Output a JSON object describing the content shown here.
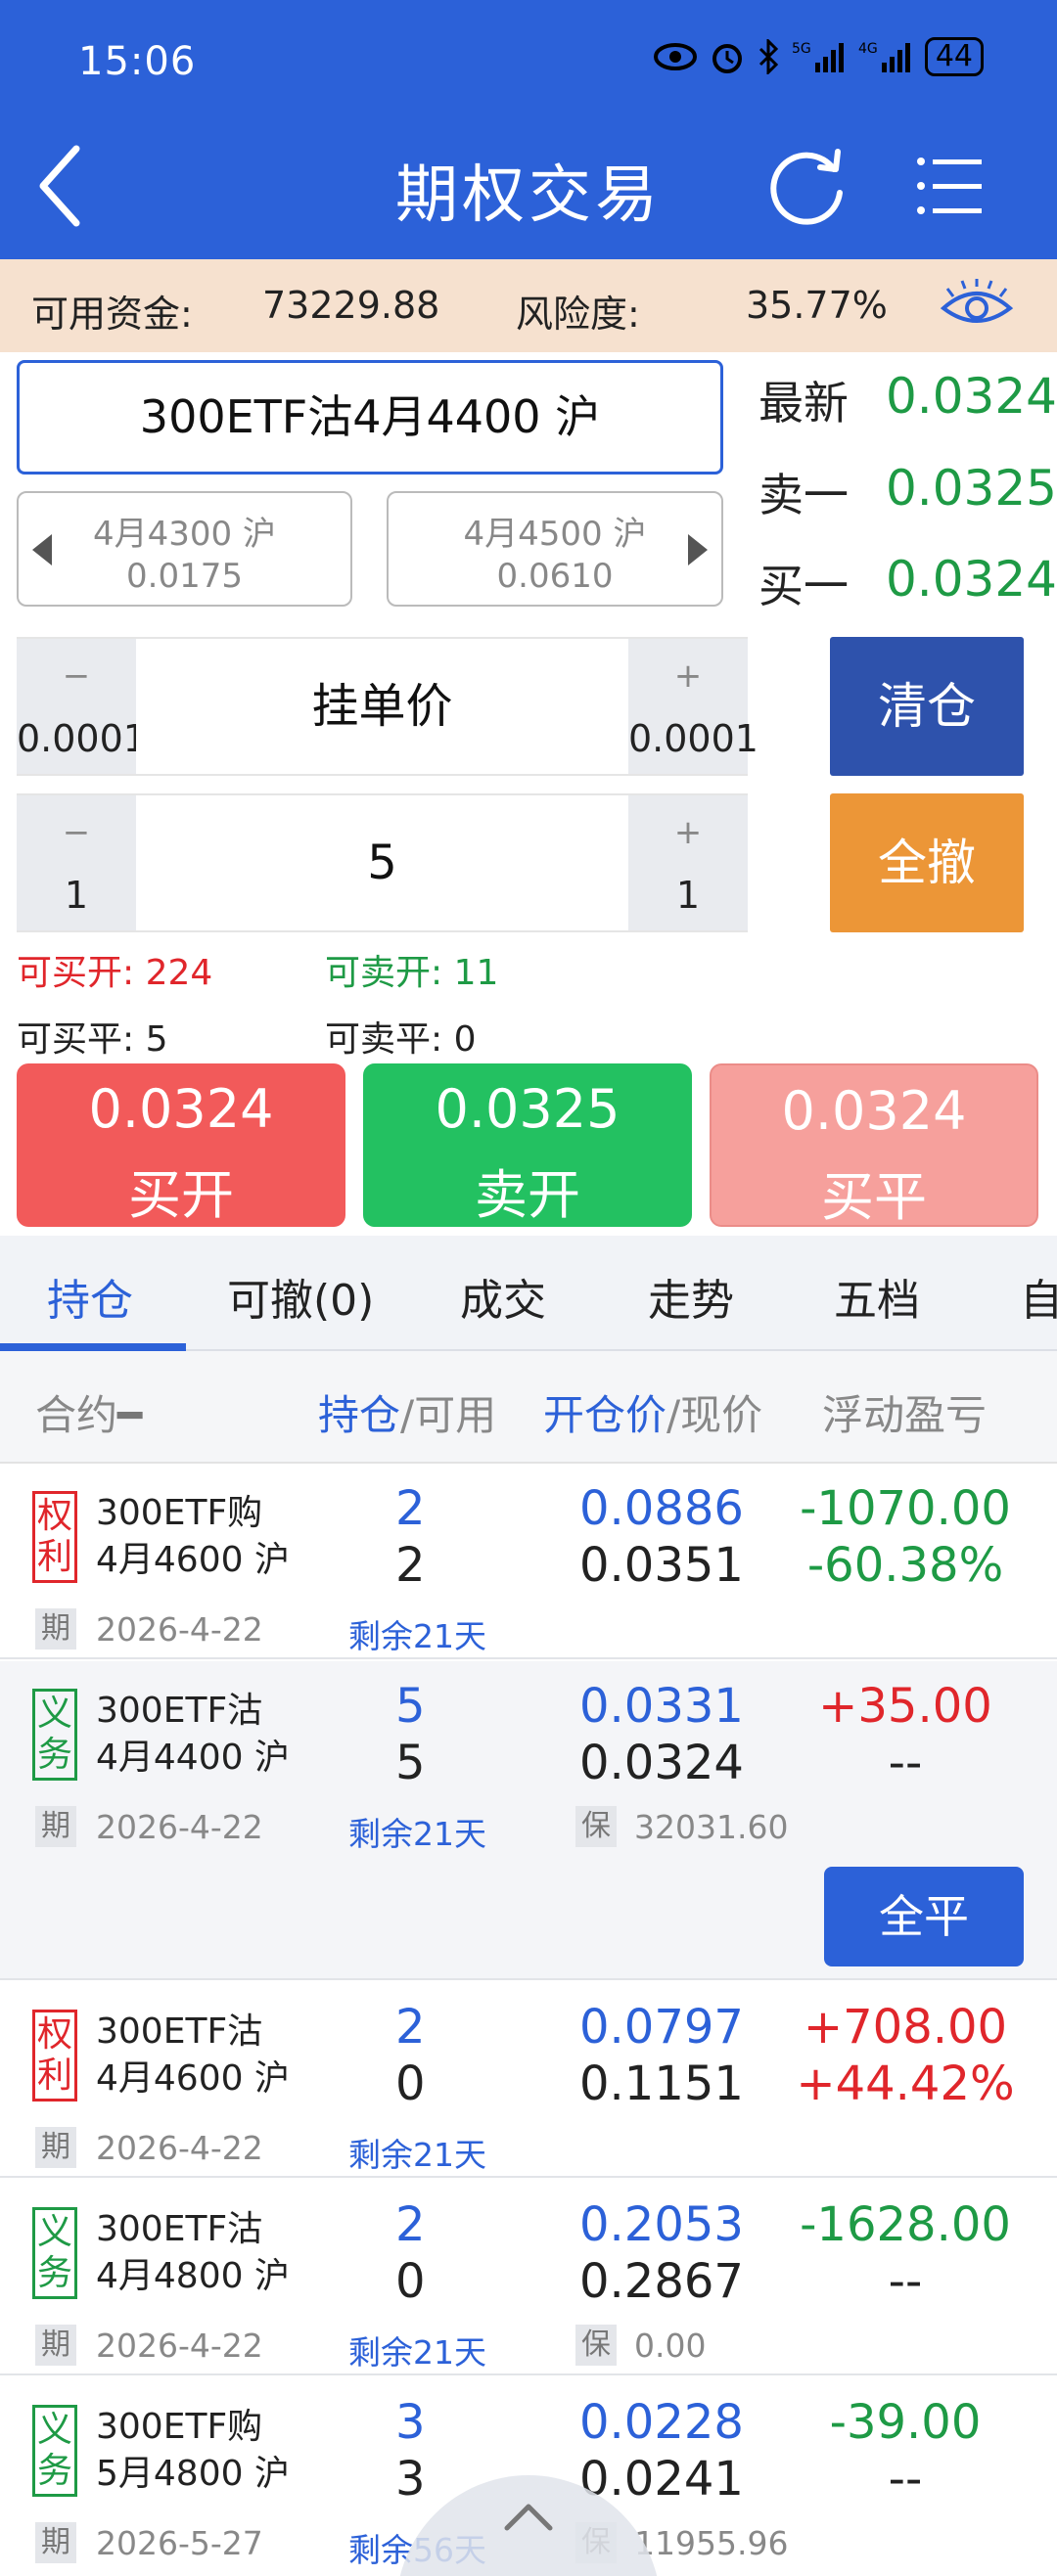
{
  "status_bar": {
    "time": "15:06",
    "battery": "44"
  },
  "nav": {
    "title": "期权交易"
  },
  "funds": {
    "available_label": "可用资金:",
    "available_value": "73229.88",
    "risk_label": "风险度:",
    "risk_value": "35.77%"
  },
  "contract": {
    "name": "300ETF沽4月4400 沪"
  },
  "adjacent": {
    "prev": {
      "name": "4月4300 沪",
      "price": "0.0175"
    },
    "next": {
      "name": "4月4500 沪",
      "price": "0.0610"
    }
  },
  "quote": [
    {
      "label": "最新",
      "value": "0.0324"
    },
    {
      "label": "卖一",
      "value": "0.0325"
    },
    {
      "label": "买一",
      "value": "0.0324"
    }
  ],
  "price_stepper": {
    "minus_sym": "−",
    "minus_step": "0.0001",
    "label": "挂单价",
    "plus_sym": "+",
    "plus_step": "0.0001"
  },
  "qty_stepper": {
    "minus_sym": "−",
    "minus_step": "1",
    "value": "5",
    "plus_sym": "+",
    "plus_step": "1"
  },
  "side_buttons": {
    "close_all": "清仓",
    "cancel_all": "全撤"
  },
  "availability": {
    "buy_open": "可买开: 224",
    "sell_open": "可卖开: 11",
    "buy_close": "可买平: 5",
    "sell_close": "可卖平: 0"
  },
  "trade_buttons": [
    {
      "price": "0.0324",
      "action": "买开",
      "color": "#f25a5a"
    },
    {
      "price": "0.0325",
      "action": "卖开",
      "color": "#23c161"
    },
    {
      "price": "0.0324",
      "action": "买平",
      "color": "#f6a09c"
    }
  ],
  "tabs": [
    "持仓",
    "可撤(0)",
    "成交",
    "走势",
    "五档",
    "自"
  ],
  "columns": {
    "contract": "合约",
    "hold": "持仓",
    "avail": "/可用",
    "open_price": "开仓价",
    "cur_price": "/现价",
    "pnl": "浮动盈亏"
  },
  "positions": [
    {
      "tag": "权利",
      "tag_color": "red",
      "line1": "300ETF购",
      "line2": "4月4600 沪",
      "hold": "2",
      "avail": "2",
      "open_price": "0.0886",
      "cur_price": "0.0351",
      "pnl": "-1070.00",
      "pnl_pct": "-60.38%",
      "pnl_color": "green",
      "meta_tag": "期",
      "date": "2026-4-22",
      "remain": "剩余21天",
      "margin_tag": "",
      "margin": ""
    },
    {
      "tag": "义务",
      "tag_color": "green",
      "line1": "300ETF沽",
      "line2": "4月4400 沪",
      "hold": "5",
      "avail": "5",
      "open_price": "0.0331",
      "cur_price": "0.0324",
      "pnl": "+35.00",
      "pnl_pct": "--",
      "pnl_color": "red",
      "meta_tag": "期",
      "date": "2026-4-22",
      "remain": "剩余21天",
      "margin_tag": "保",
      "margin": "32031.60",
      "close_btn": "全平"
    },
    {
      "tag": "权利",
      "tag_color": "red",
      "line1": "300ETF沽",
      "line2": "4月4600 沪",
      "hold": "2",
      "avail": "0",
      "open_price": "0.0797",
      "cur_price": "0.1151",
      "pnl": "+708.00",
      "pnl_pct": "+44.42%",
      "pnl_color": "red",
      "meta_tag": "期",
      "date": "2026-4-22",
      "remain": "剩余21天",
      "margin_tag": "",
      "margin": ""
    },
    {
      "tag": "义务",
      "tag_color": "green",
      "line1": "300ETF沽",
      "line2": "4月4800 沪",
      "hold": "2",
      "avail": "0",
      "open_price": "0.2053",
      "cur_price": "0.2867",
      "pnl": "-1628.00",
      "pnl_pct": "--",
      "pnl_color": "green",
      "meta_tag": "期",
      "date": "2026-4-22",
      "remain": "剩余21天",
      "margin_tag": "保",
      "margin": "0.00"
    },
    {
      "tag": "义务",
      "tag_color": "green",
      "line1": "300ETF购",
      "line2": "5月4800 沪",
      "hold": "3",
      "avail": "3",
      "open_price": "0.0228",
      "cur_price": "0.0241",
      "pnl": "-39.00",
      "pnl_pct": "--",
      "pnl_color": "green",
      "meta_tag": "期",
      "date": "2026-5-27",
      "remain": "剩余56天",
      "margin_tag": "保",
      "margin": "11955.96"
    }
  ]
}
